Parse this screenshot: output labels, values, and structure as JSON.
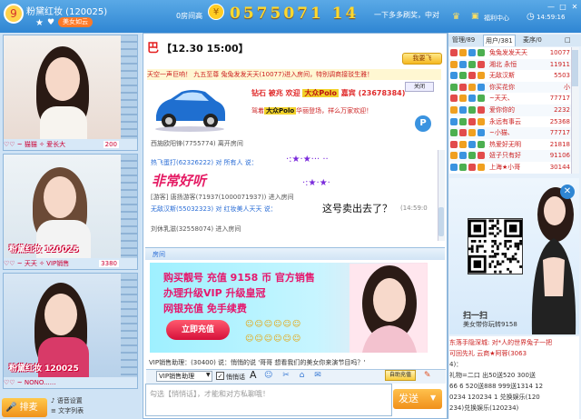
{
  "titlebar": {
    "room_name": "粉黛红妆 (120025)",
    "tag": "美女如云",
    "room_no_label": "0房间高",
    "room_number": "0575071 14",
    "marquee": "一下多多刷奖，中对",
    "welfare": "福利中心",
    "clock": "14:59:16",
    "win_min": "—",
    "win_max": "□",
    "win_close": "✕",
    "logo_glyph": "9"
  },
  "left": {
    "cams": [
      {
        "footer": "♡♡ ~ 猫猫 ✧ 爱长大",
        "count": "200",
        "logo": ""
      },
      {
        "footer": "♡♡ ~ 天天 ✧ VIP销售",
        "count": "3380",
        "logo": "粉黛红妆 120025"
      },
      {
        "footer": "♡♡ ~ NONO......",
        "count": "",
        "logo": "粉黛红妆 120025"
      }
    ],
    "mic_label": "排麦",
    "tools": [
      "语音设置",
      "文字列表",
      "录制"
    ]
  },
  "main": {
    "pin": "【12.30  15:00】",
    "pin_icon": "巴",
    "plane_btn": "我要飞",
    "announce": "天空一声巨响！ 九五至尊 兔兔发发天天(10077)进入房间，特别调商接驳生雅！",
    "car_msg1_pre": "钻石 被兆 欢迎",
    "car_msg1_b": "大众Polo",
    "car_msg1_post": "嘉宾 (23678384)",
    "car_msg2_pre": "驾着",
    "car_msg2_b": "大众Polo",
    "car_msg2_post": "华丽登场，祥么万家欢迎！",
    "car_close": "关闭",
    "p_badge": "P",
    "chat": [
      {
        "text": "西施欧阳锋(7755774) 离开房间"
      },
      {
        "text": "热飞蛋打(62326222) 对 所有人 说："
      },
      {
        "text": "[游客] 唐扬游客(71937(1000071937)) 进入房间"
      },
      {
        "text": "无敌汉斯(55032323) 对 红妆美人天天 说："
      },
      {
        "text": "刘休乳滋(32558074) 进入房间"
      }
    ],
    "big_text": "非常好听",
    "sparkle1": "·:★·★··· ··",
    "sparkle2": "·:★·★·",
    "chat_q": "这号卖出去了？",
    "chat_time": "(14:59:0",
    "divider_label": "房间",
    "ad": {
      "l1": "购买靓号 充值 9158 币 官方销售",
      "l2": "办理升级VIP 升级皇冠",
      "l3": "网银充值 免手续费",
      "btn": "立即充值",
      "arrow": "▶"
    },
    "emoji1": "☺☺☺☺☺☺",
    "emoji2": "☺☺☺☺☺☺",
    "sys_msg": "VIP销售助理：(30400) 说：悄悄的说 '哥哥 想看我们的美女你来演节目吗？'",
    "assist": "VIP销售助理",
    "check_label": "悄悄话",
    "font_a": "A",
    "tool_icons": "☺ ✂ ⌂ ✉",
    "auto_btn": "自助充值",
    "clear_icon": "✎",
    "input_ph": "勾选【悄悄话】，才能和对方私聊哦！",
    "send": "发送",
    "send_arrow": "▼"
  },
  "right": {
    "tabs": [
      "管理/89",
      "用户/381",
      "麦序/0",
      "□"
    ],
    "users": [
      {
        "nm": "兔兔发发天天",
        "num": "10077"
      },
      {
        "nm": "湘北 永恒",
        "num": "11911"
      },
      {
        "nm": "无敌汉斯",
        "num": "5503"
      },
      {
        "nm": "你买花你",
        "num": "小"
      },
      {
        "nm": "~天天、",
        "num": "77717"
      },
      {
        "nm": "爱你你的",
        "num": "2232"
      },
      {
        "nm": "永远有事云",
        "num": "25368"
      },
      {
        "nm": "~小猫、",
        "num": "77717"
      },
      {
        "nm": "热爱好无明",
        "num": "21818"
      },
      {
        "nm": "妞子只有好",
        "num": "91106"
      },
      {
        "nm": "上海★小哥",
        "num": "30144"
      }
    ],
    "qr_caption": "扫一扫",
    "qr_caption2": "美女带你玩转9158",
    "close": "✕",
    "chat": [
      {
        "text": "东落手隐深城: 对*人的世界兔子一把"
      },
      {
        "text": "可回先礼  云商★阿蓉(3063"
      },
      {
        "text": "4)："
      },
      {
        "text": "礼物=二口 出50送520 300送"
      },
      {
        "text": "66 6 520送888 999送1314 12"
      },
      {
        "text": "0234 120234 1 兑换娱乐(120"
      },
      {
        "text": "234)兑换娱乐(120234)"
      }
    ]
  },
  "colors": {
    "accent": "#2f86d3",
    "gold": "#ffd92e",
    "chat_red": "#c22",
    "pink": "#e51b64"
  }
}
